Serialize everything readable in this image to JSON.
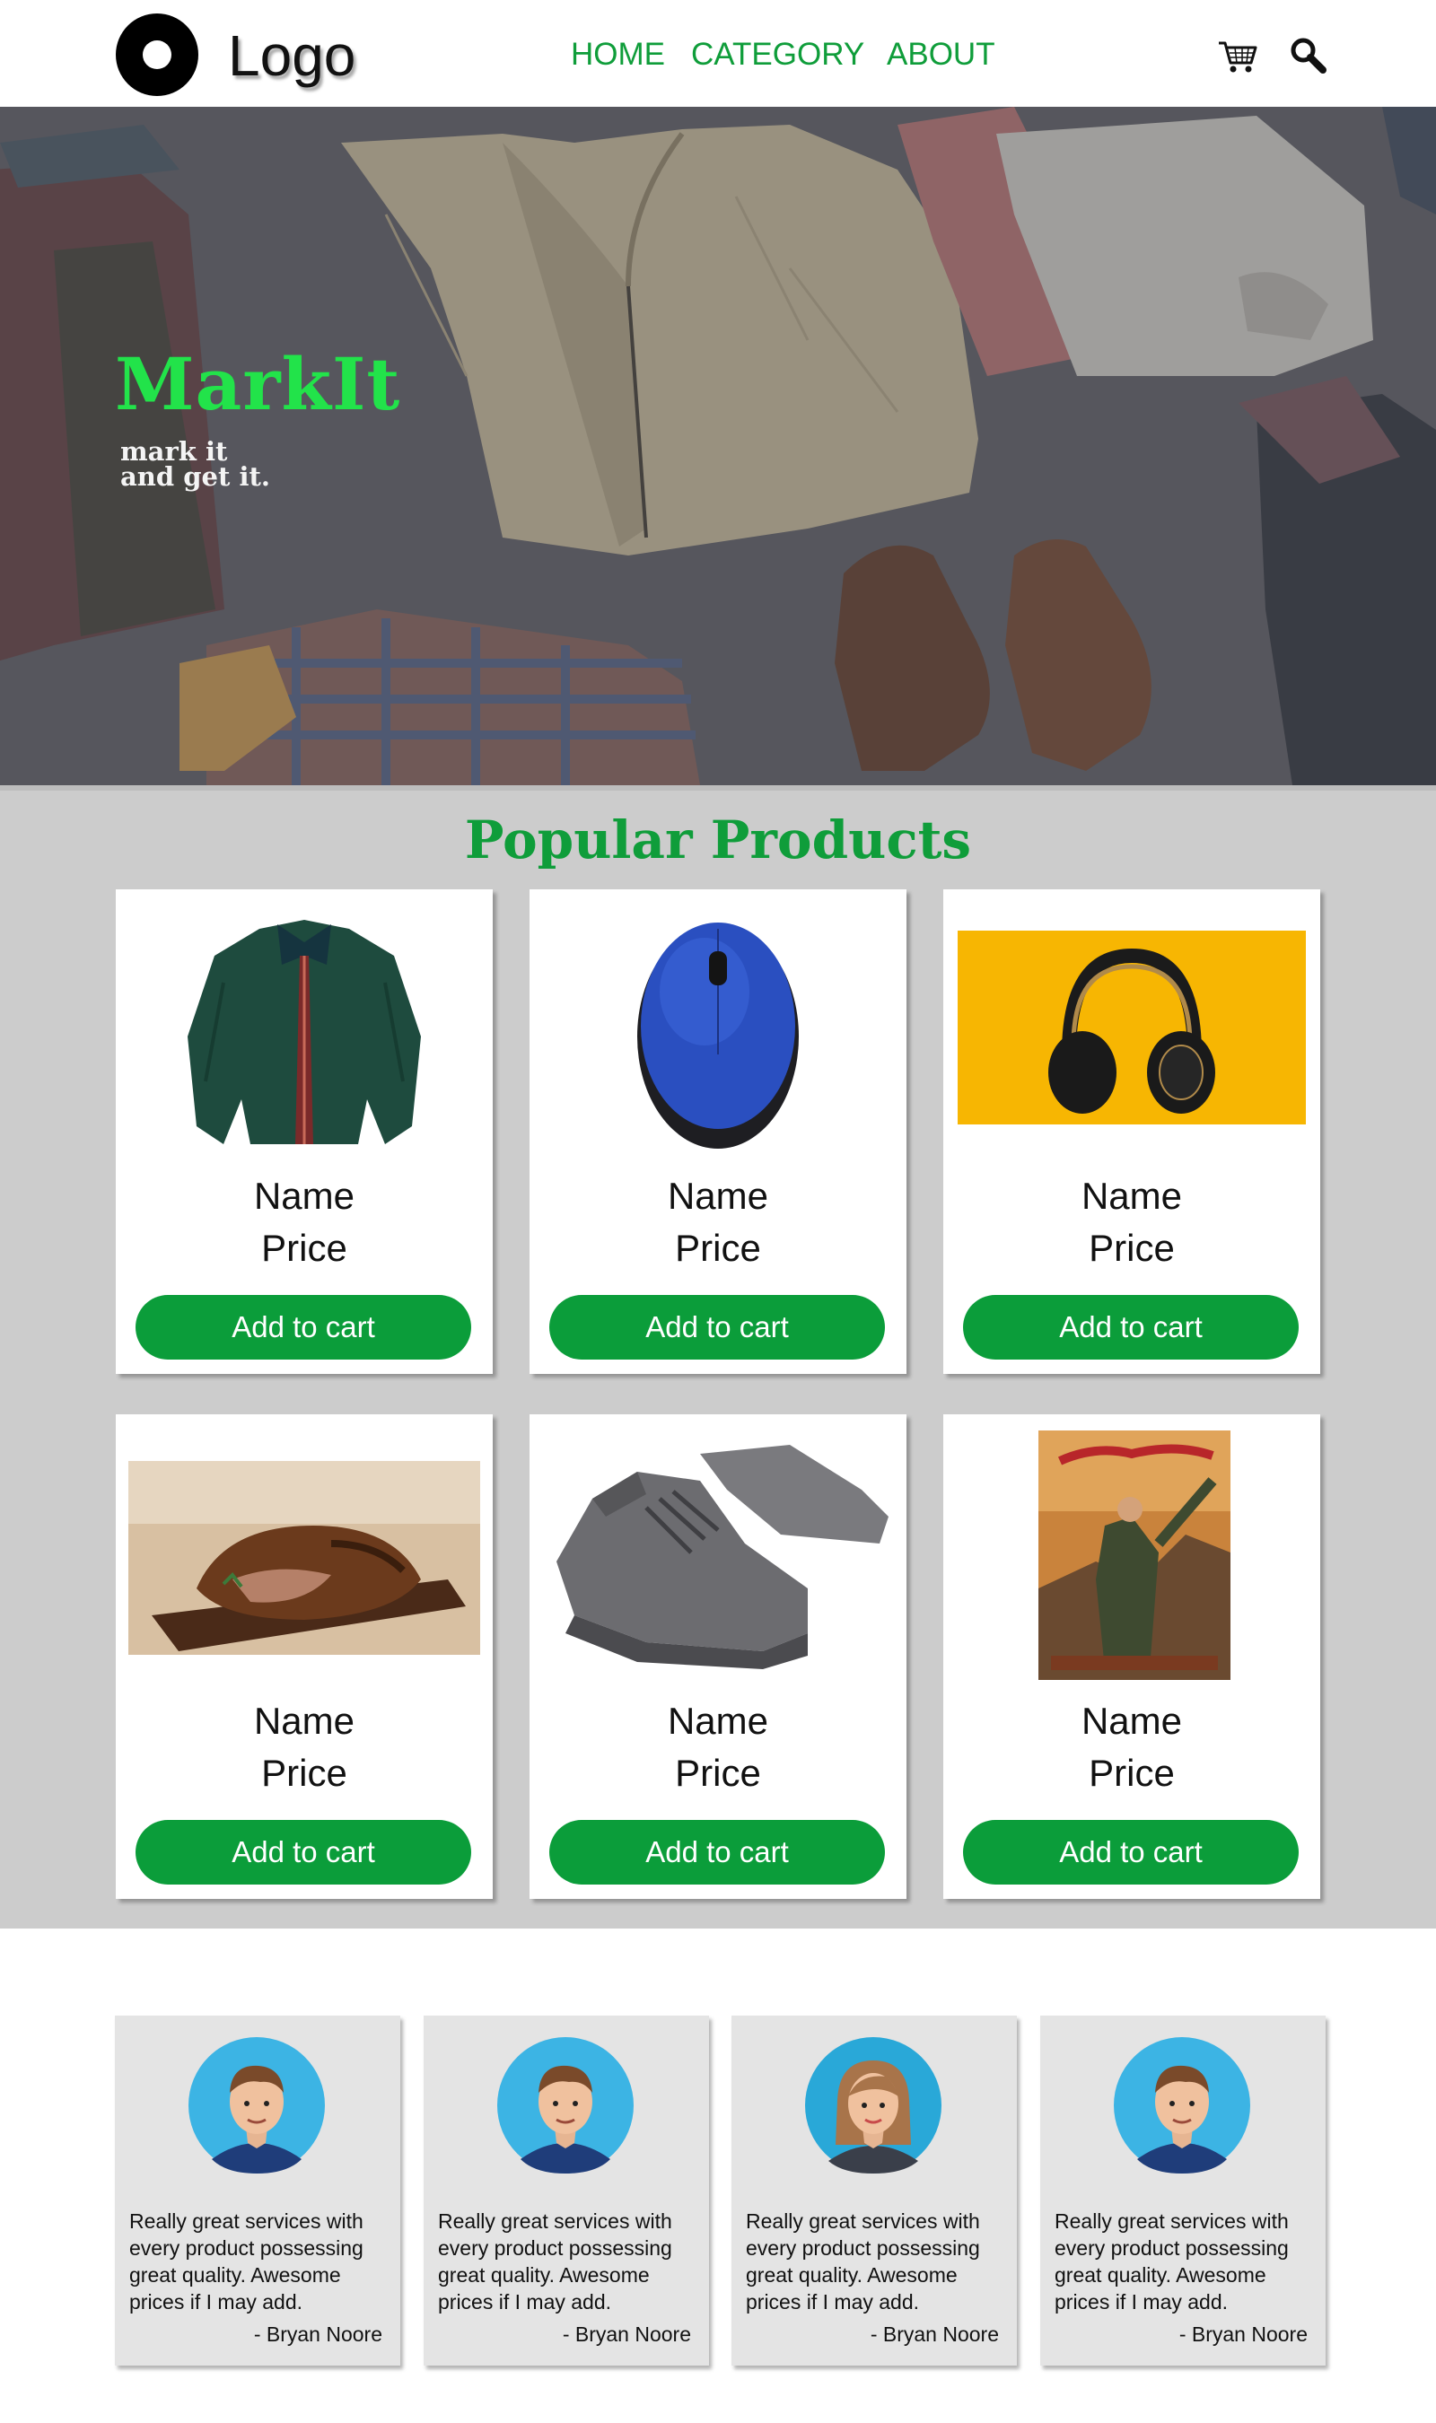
{
  "header": {
    "logo_text": "Logo",
    "nav": [
      "HOME",
      "CATEGORY",
      "ABOUT"
    ],
    "icons": [
      "cart-icon",
      "search-icon"
    ]
  },
  "hero": {
    "title": "MarkIt",
    "tagline_line1": "mark it",
    "tagline_line2": "and get it."
  },
  "popular": {
    "title": "Popular Products",
    "products": [
      {
        "image": "green-jacket",
        "name": "Name",
        "price": "Price",
        "button": "Add to cart"
      },
      {
        "image": "blue-mouse",
        "name": "Name",
        "price": "Price",
        "button": "Add to cart"
      },
      {
        "image": "headphones",
        "name": "Name",
        "price": "Price",
        "button": "Add to cart"
      },
      {
        "image": "roast-meat",
        "name": "Name",
        "price": "Price",
        "button": "Add to cart"
      },
      {
        "image": "grey-sneakers",
        "name": "Name",
        "price": "Price",
        "button": "Add to cart"
      },
      {
        "image": "harry-potter-book",
        "name": "Name",
        "price": "Price",
        "button": "Add to cart"
      }
    ]
  },
  "testimonials": [
    {
      "avatar": "male-avatar",
      "quote": "Really great services with every product possessing great quality. Awesome prices if I may add.",
      "author": "- Bryan Noore"
    },
    {
      "avatar": "male-avatar",
      "quote": "Really great services with every product possessing great quality. Awesome prices if I may add.",
      "author": "- Bryan Noore"
    },
    {
      "avatar": "female-avatar",
      "quote": "Really great services with every product possessing great quality. Awesome prices if I may add.",
      "author": "- Bryan Noore"
    },
    {
      "avatar": "male-avatar",
      "quote": "Really great services with every product possessing great quality. Awesome prices if I may add.",
      "author": "- Bryan Noore"
    }
  ],
  "colors": {
    "brand_green": "#0f9d3a",
    "hero_title_green": "#22e34a",
    "products_bg": "#cccccc",
    "testimonial_bg": "#e4e4e4"
  }
}
